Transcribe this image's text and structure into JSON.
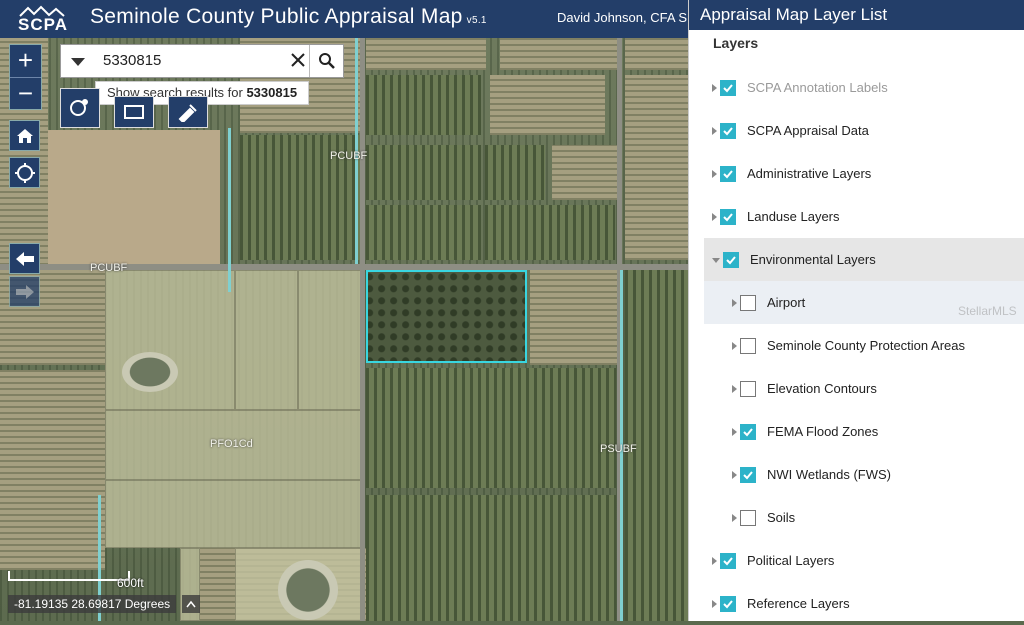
{
  "app": {
    "logo_text": "SCPA",
    "title": "Seminole County Public Appraisal Map",
    "version": "v5.1",
    "user": "David Johnson, CFA S"
  },
  "search": {
    "value": "5330815",
    "suggestion_prefix": "Show search results for ",
    "suggestion_term": "5330815"
  },
  "map": {
    "labels": [
      "PFO1Cd",
      "PCUBF",
      "PCUBF",
      "PSUBF"
    ],
    "scale_label": "600ft",
    "coordinates": "-81.19135 28.69817 Degrees"
  },
  "icons": {
    "zoom_in": "+",
    "zoom_out": "−",
    "home": "home-icon",
    "locate": "locate-icon",
    "back": "back-arrow-icon",
    "forward": "forward-arrow-icon",
    "search": "search-icon",
    "clear": "close-icon"
  },
  "panel": {
    "title": "Appraisal Map Layer List",
    "subtitle": "Layers",
    "watermark": "StellarMLS",
    "layers": [
      {
        "label": "SCPA Annotation Labels",
        "checked": true
      },
      {
        "label": "SCPA Appraisal Data",
        "checked": true
      },
      {
        "label": "Administrative Layers",
        "checked": true
      },
      {
        "label": "Landuse Layers",
        "checked": true
      },
      {
        "label": "Environmental Layers",
        "checked": true
      },
      {
        "label": "Airport",
        "checked": false
      },
      {
        "label": "Seminole County Protection Areas",
        "checked": false
      },
      {
        "label": "Elevation Contours",
        "checked": false
      },
      {
        "label": "FEMA Flood Zones",
        "checked": true
      },
      {
        "label": "NWI Wetlands (FWS)",
        "checked": true
      },
      {
        "label": "Soils",
        "checked": false
      },
      {
        "label": "Political Layers",
        "checked": true
      },
      {
        "label": "Reference Layers",
        "checked": true
      }
    ]
  },
  "colors": {
    "header": "#233e69",
    "checkbox": "#2cb3c9",
    "selection": "#39d6e0"
  }
}
